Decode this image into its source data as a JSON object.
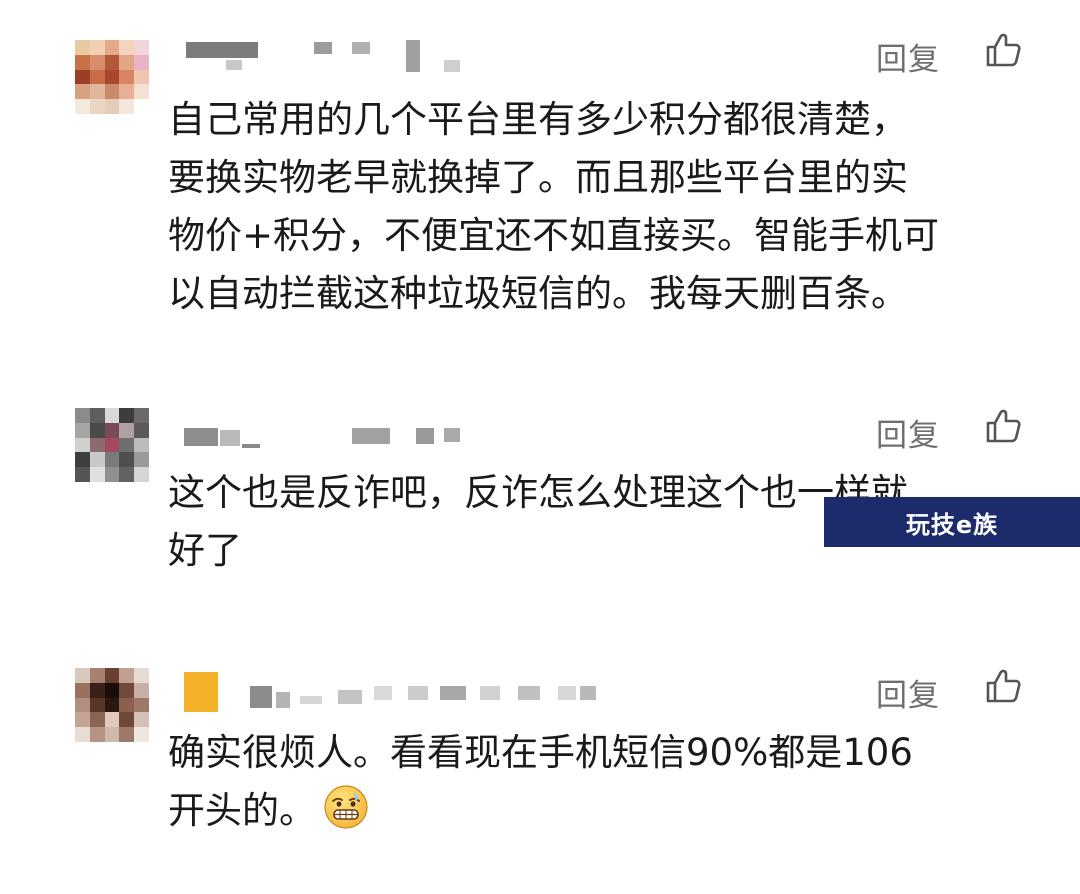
{
  "comments": [
    {
      "reply_label": "回复",
      "like_icon": "thumbs-up-icon",
      "text_lines": [
        "自己常用的几个平台里有多少积分都很清楚，",
        "要换实物老早就换掉了。而且那些平台里的实",
        "物价+积分，不便宜还不如直接买。智能手机可",
        "以自动拦截这种垃圾短信的。我每天删百条。"
      ]
    },
    {
      "reply_label": "回复",
      "like_icon": "thumbs-up-icon",
      "text_lines": [
        "这个也是反诈吧，反诈怎么处理这个也一样就",
        "好了"
      ]
    },
    {
      "reply_label": "回复",
      "like_icon": "thumbs-up-icon",
      "text_lines": [
        "确实很烦人。看看现在手机短信90%都是106",
        "开头的。"
      ],
      "emoji_icon": "grimace-emoji-icon"
    }
  ],
  "watermark": {
    "text": "玩技e族",
    "background": "#1b2b6b"
  },
  "colors": {
    "text": "#1a1a1a",
    "secondary": "#6f6f6f"
  }
}
